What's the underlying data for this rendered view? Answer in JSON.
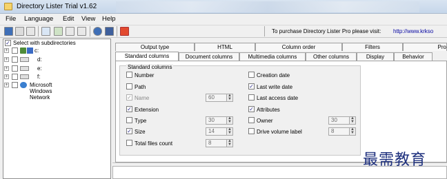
{
  "window": {
    "title": "Directory Lister Trial v1.62"
  },
  "menu": [
    "File",
    "Language",
    "Edit",
    "View",
    "Help"
  ],
  "toolbar": {
    "promo_text": "To purchase Directory Lister Pro please visit:",
    "promo_url": "http://www.krkso"
  },
  "tree": {
    "select_label": "Select with subdirectories",
    "items": [
      {
        "label": "c:",
        "icon": "drive-c-icon"
      },
      {
        "label": "d:",
        "icon": "drive-icon"
      },
      {
        "label": "e:",
        "icon": "drive-icon"
      },
      {
        "label": "f:",
        "icon": "drive-icon"
      },
      {
        "label": "Microsoft Windows Network",
        "icon": "network-icon"
      }
    ]
  },
  "tabs_top": [
    "Output type",
    "HTML",
    "Column order",
    "Filters",
    "Pro"
  ],
  "tabs_bottom": [
    "Standard columns",
    "Document columns",
    "Multimedia columns",
    "Other columns",
    "Display",
    "Behavior"
  ],
  "group_title": "Standard columns",
  "left_options": [
    {
      "label": "Number",
      "checked": false,
      "spin": null
    },
    {
      "label": "Path",
      "checked": false,
      "spin": null
    },
    {
      "label": "Name",
      "checked": true,
      "disabled": true,
      "spin": "60"
    },
    {
      "label": "Extension",
      "checked": true,
      "spin": null
    },
    {
      "label": "Type",
      "checked": false,
      "spin": "30"
    },
    {
      "label": "Size",
      "checked": true,
      "spin": "14"
    },
    {
      "label": "Total files count",
      "checked": false,
      "spin": "8"
    }
  ],
  "right_options": [
    {
      "label": "Creation date",
      "checked": false,
      "spin": null
    },
    {
      "label": "Last write date",
      "checked": true,
      "spin": null
    },
    {
      "label": "Last access date",
      "checked": false,
      "spin": null
    },
    {
      "label": "Attributes",
      "checked": true,
      "spin": null
    },
    {
      "label": "Owner",
      "checked": false,
      "spin": "30"
    },
    {
      "label": "Drive volume label",
      "checked": false,
      "spin": "8"
    }
  ],
  "watermark": "最需教育",
  "colors": {
    "accent": "#0000a0",
    "check": "#2b2b8a",
    "titlebar": "#c5d6ea"
  }
}
